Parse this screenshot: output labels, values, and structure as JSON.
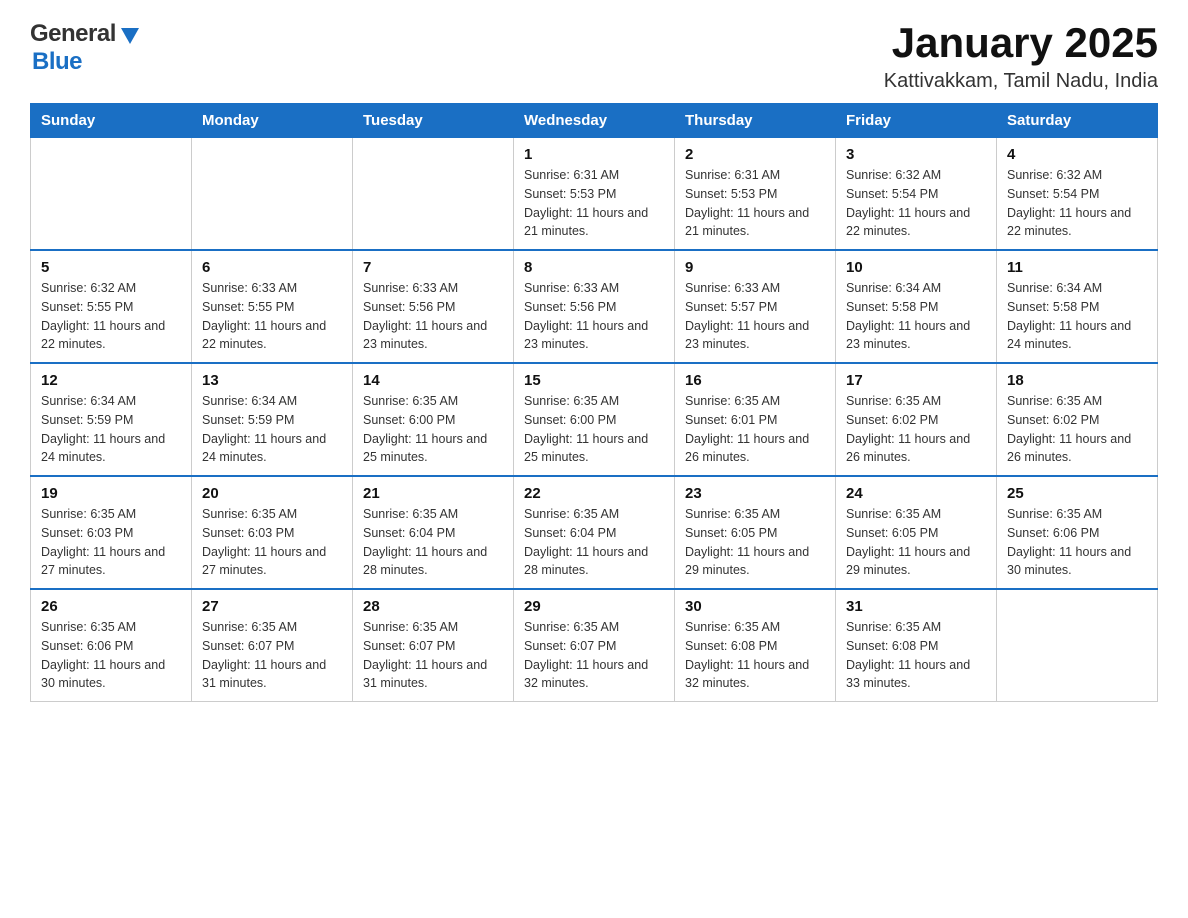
{
  "header": {
    "logo": {
      "general": "General",
      "blue": "Blue"
    },
    "title": "January 2025",
    "subtitle": "Kattivakkam, Tamil Nadu, India"
  },
  "calendar": {
    "days": [
      "Sunday",
      "Monday",
      "Tuesday",
      "Wednesday",
      "Thursday",
      "Friday",
      "Saturday"
    ],
    "weeks": [
      [
        {
          "day": "",
          "sunrise": "",
          "sunset": "",
          "daylight": ""
        },
        {
          "day": "",
          "sunrise": "",
          "sunset": "",
          "daylight": ""
        },
        {
          "day": "",
          "sunrise": "",
          "sunset": "",
          "daylight": ""
        },
        {
          "day": "1",
          "sunrise": "Sunrise: 6:31 AM",
          "sunset": "Sunset: 5:53 PM",
          "daylight": "Daylight: 11 hours and 21 minutes."
        },
        {
          "day": "2",
          "sunrise": "Sunrise: 6:31 AM",
          "sunset": "Sunset: 5:53 PM",
          "daylight": "Daylight: 11 hours and 21 minutes."
        },
        {
          "day": "3",
          "sunrise": "Sunrise: 6:32 AM",
          "sunset": "Sunset: 5:54 PM",
          "daylight": "Daylight: 11 hours and 22 minutes."
        },
        {
          "day": "4",
          "sunrise": "Sunrise: 6:32 AM",
          "sunset": "Sunset: 5:54 PM",
          "daylight": "Daylight: 11 hours and 22 minutes."
        }
      ],
      [
        {
          "day": "5",
          "sunrise": "Sunrise: 6:32 AM",
          "sunset": "Sunset: 5:55 PM",
          "daylight": "Daylight: 11 hours and 22 minutes."
        },
        {
          "day": "6",
          "sunrise": "Sunrise: 6:33 AM",
          "sunset": "Sunset: 5:55 PM",
          "daylight": "Daylight: 11 hours and 22 minutes."
        },
        {
          "day": "7",
          "sunrise": "Sunrise: 6:33 AM",
          "sunset": "Sunset: 5:56 PM",
          "daylight": "Daylight: 11 hours and 23 minutes."
        },
        {
          "day": "8",
          "sunrise": "Sunrise: 6:33 AM",
          "sunset": "Sunset: 5:56 PM",
          "daylight": "Daylight: 11 hours and 23 minutes."
        },
        {
          "day": "9",
          "sunrise": "Sunrise: 6:33 AM",
          "sunset": "Sunset: 5:57 PM",
          "daylight": "Daylight: 11 hours and 23 minutes."
        },
        {
          "day": "10",
          "sunrise": "Sunrise: 6:34 AM",
          "sunset": "Sunset: 5:58 PM",
          "daylight": "Daylight: 11 hours and 23 minutes."
        },
        {
          "day": "11",
          "sunrise": "Sunrise: 6:34 AM",
          "sunset": "Sunset: 5:58 PM",
          "daylight": "Daylight: 11 hours and 24 minutes."
        }
      ],
      [
        {
          "day": "12",
          "sunrise": "Sunrise: 6:34 AM",
          "sunset": "Sunset: 5:59 PM",
          "daylight": "Daylight: 11 hours and 24 minutes."
        },
        {
          "day": "13",
          "sunrise": "Sunrise: 6:34 AM",
          "sunset": "Sunset: 5:59 PM",
          "daylight": "Daylight: 11 hours and 24 minutes."
        },
        {
          "day": "14",
          "sunrise": "Sunrise: 6:35 AM",
          "sunset": "Sunset: 6:00 PM",
          "daylight": "Daylight: 11 hours and 25 minutes."
        },
        {
          "day": "15",
          "sunrise": "Sunrise: 6:35 AM",
          "sunset": "Sunset: 6:00 PM",
          "daylight": "Daylight: 11 hours and 25 minutes."
        },
        {
          "day": "16",
          "sunrise": "Sunrise: 6:35 AM",
          "sunset": "Sunset: 6:01 PM",
          "daylight": "Daylight: 11 hours and 26 minutes."
        },
        {
          "day": "17",
          "sunrise": "Sunrise: 6:35 AM",
          "sunset": "Sunset: 6:02 PM",
          "daylight": "Daylight: 11 hours and 26 minutes."
        },
        {
          "day": "18",
          "sunrise": "Sunrise: 6:35 AM",
          "sunset": "Sunset: 6:02 PM",
          "daylight": "Daylight: 11 hours and 26 minutes."
        }
      ],
      [
        {
          "day": "19",
          "sunrise": "Sunrise: 6:35 AM",
          "sunset": "Sunset: 6:03 PM",
          "daylight": "Daylight: 11 hours and 27 minutes."
        },
        {
          "day": "20",
          "sunrise": "Sunrise: 6:35 AM",
          "sunset": "Sunset: 6:03 PM",
          "daylight": "Daylight: 11 hours and 27 minutes."
        },
        {
          "day": "21",
          "sunrise": "Sunrise: 6:35 AM",
          "sunset": "Sunset: 6:04 PM",
          "daylight": "Daylight: 11 hours and 28 minutes."
        },
        {
          "day": "22",
          "sunrise": "Sunrise: 6:35 AM",
          "sunset": "Sunset: 6:04 PM",
          "daylight": "Daylight: 11 hours and 28 minutes."
        },
        {
          "day": "23",
          "sunrise": "Sunrise: 6:35 AM",
          "sunset": "Sunset: 6:05 PM",
          "daylight": "Daylight: 11 hours and 29 minutes."
        },
        {
          "day": "24",
          "sunrise": "Sunrise: 6:35 AM",
          "sunset": "Sunset: 6:05 PM",
          "daylight": "Daylight: 11 hours and 29 minutes."
        },
        {
          "day": "25",
          "sunrise": "Sunrise: 6:35 AM",
          "sunset": "Sunset: 6:06 PM",
          "daylight": "Daylight: 11 hours and 30 minutes."
        }
      ],
      [
        {
          "day": "26",
          "sunrise": "Sunrise: 6:35 AM",
          "sunset": "Sunset: 6:06 PM",
          "daylight": "Daylight: 11 hours and 30 minutes."
        },
        {
          "day": "27",
          "sunrise": "Sunrise: 6:35 AM",
          "sunset": "Sunset: 6:07 PM",
          "daylight": "Daylight: 11 hours and 31 minutes."
        },
        {
          "day": "28",
          "sunrise": "Sunrise: 6:35 AM",
          "sunset": "Sunset: 6:07 PM",
          "daylight": "Daylight: 11 hours and 31 minutes."
        },
        {
          "day": "29",
          "sunrise": "Sunrise: 6:35 AM",
          "sunset": "Sunset: 6:07 PM",
          "daylight": "Daylight: 11 hours and 32 minutes."
        },
        {
          "day": "30",
          "sunrise": "Sunrise: 6:35 AM",
          "sunset": "Sunset: 6:08 PM",
          "daylight": "Daylight: 11 hours and 32 minutes."
        },
        {
          "day": "31",
          "sunrise": "Sunrise: 6:35 AM",
          "sunset": "Sunset: 6:08 PM",
          "daylight": "Daylight: 11 hours and 33 minutes."
        },
        {
          "day": "",
          "sunrise": "",
          "sunset": "",
          "daylight": ""
        }
      ]
    ]
  }
}
